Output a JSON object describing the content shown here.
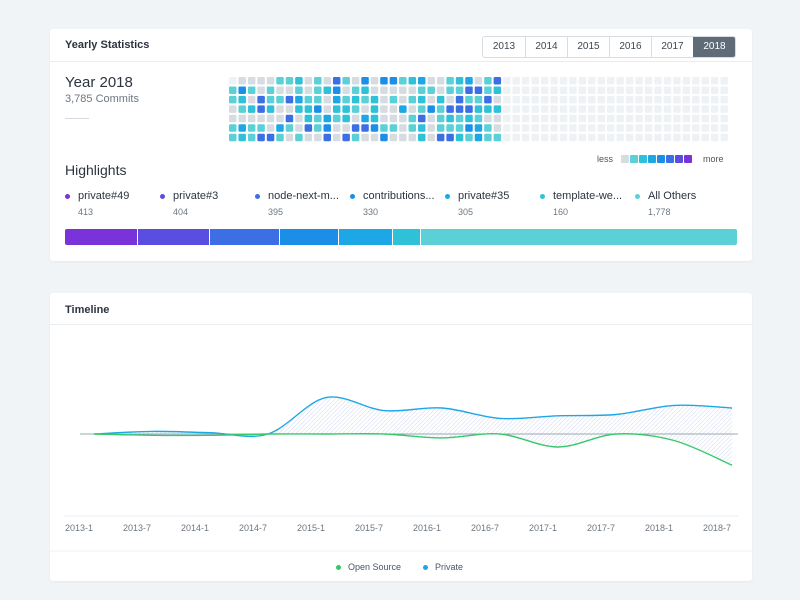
{
  "stats": {
    "title": "Yearly Statistics",
    "year_tabs": [
      "2013",
      "2014",
      "2015",
      "2016",
      "2017",
      "2018"
    ],
    "active_year": "2018",
    "year_title": "Year 2018",
    "commit_count": "3,785 Commits",
    "legend_less": "less",
    "legend_more": "more",
    "legend_colors": [
      "#d7dce0",
      "#5bd0d6",
      "#2fc1d8",
      "#1ea7e6",
      "#1b8fe8",
      "#3c6fe3",
      "#5a4ee0",
      "#7a33d9"
    ],
    "highlights_title": "Highlights",
    "repos": [
      {
        "name": "private#49",
        "count": "413",
        "color": "#7a33d9",
        "value": 413
      },
      {
        "name": "private#3",
        "count": "404",
        "color": "#5a4ee0",
        "value": 404
      },
      {
        "name": "node-next-m...",
        "count": "395",
        "color": "#3c6fe3",
        "value": 395
      },
      {
        "name": "contributions...",
        "count": "330",
        "color": "#1b8fe8",
        "value": 330
      },
      {
        "name": "private#35",
        "count": "305",
        "color": "#1ea7e6",
        "value": 305
      },
      {
        "name": "template-we...",
        "count": "160",
        "color": "#2fc1d8",
        "value": 160
      },
      {
        "name": "All Others",
        "count": "1,778",
        "color": "#5bd0d6",
        "value": 1778
      }
    ]
  },
  "timeline": {
    "title": "Timeline",
    "legend": [
      {
        "label": "Open Source",
        "color": "#36c96a"
      },
      {
        "label": "Private",
        "color": "#1ea7e6"
      }
    ]
  },
  "chart_data": {
    "type": "area",
    "title": "Timeline",
    "categories": [
      "2013-1",
      "2013-7",
      "2014-1",
      "2014-7",
      "2015-1",
      "2015-7",
      "2016-1",
      "2016-7",
      "2017-1",
      "2017-7",
      "2018-1",
      "2018-7"
    ],
    "series": [
      {
        "name": "Private",
        "color": "#1ea7e6",
        "values": [
          0,
          2,
          1,
          0,
          28,
          18,
          20,
          12,
          14,
          15,
          22,
          20
        ]
      },
      {
        "name": "Open Source",
        "color": "#36c96a",
        "values": [
          0,
          -1,
          -1,
          0,
          0,
          0,
          -3,
          0,
          -10,
          0,
          -5,
          -24
        ]
      }
    ],
    "grid": false,
    "legend_position": "bottom"
  }
}
